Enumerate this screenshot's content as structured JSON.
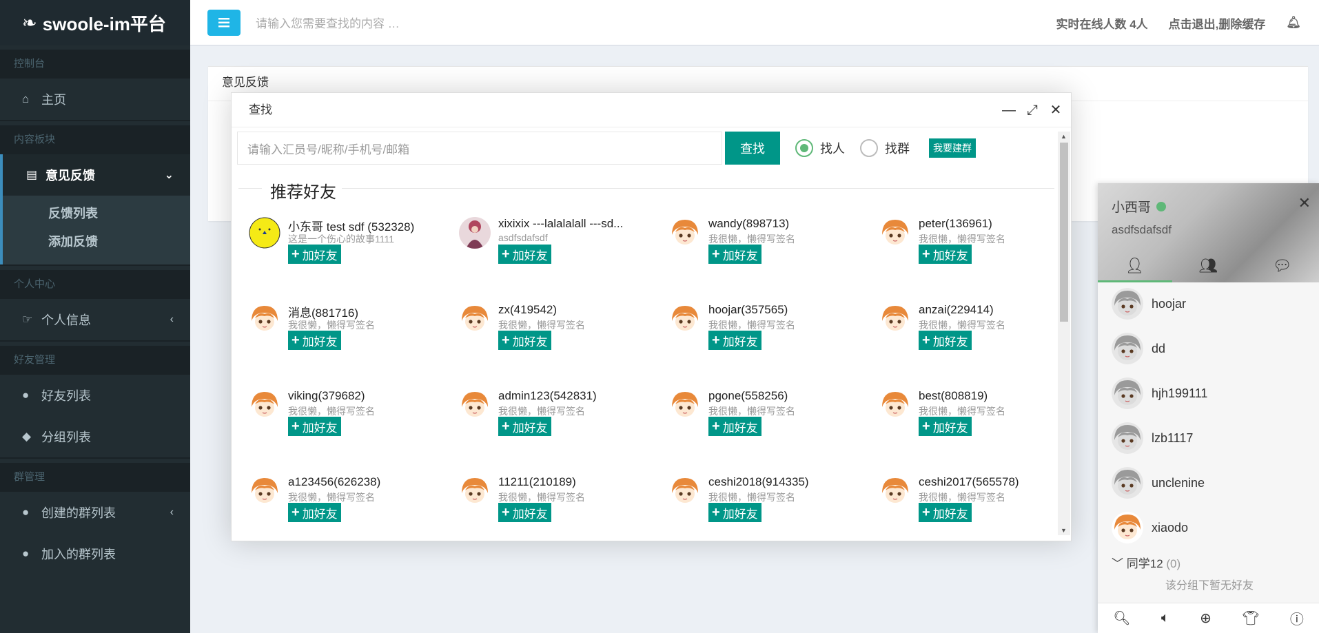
{
  "app": {
    "title": "swoole-im平台"
  },
  "sidebar": {
    "sections": [
      {
        "header": "控制台"
      },
      {
        "header": "内容板块"
      },
      {
        "header": "个人中心"
      },
      {
        "header": "好友管理"
      },
      {
        "header": "群管理"
      }
    ],
    "items": {
      "home": "主页",
      "feedback": "意见反馈",
      "feedback_list": "反馈列表",
      "feedback_add": "添加反馈",
      "profile": "个人信息",
      "friend_list": "好友列表",
      "group_list": "分组列表",
      "created_groups": "创建的群列表",
      "joined_groups": "加入的群列表"
    }
  },
  "topbar": {
    "search_placeholder": "请输入您需要查找的内容 …",
    "online_count": "实时在线人数 4人",
    "logout": "点击退出,删除缓存"
  },
  "panel": {
    "title": "意见反馈"
  },
  "modal": {
    "title": "查找",
    "search_placeholder": "请输入汇员号/昵称/手机号/邮箱",
    "search_button": "查找",
    "radio_person": "找人",
    "radio_group": "找群",
    "create_group": "我要建群",
    "recommend_title": "推荐好友",
    "add_label": "加好友",
    "users": [
      {
        "name": "小东哥 test sdf (532328)",
        "sign": "这是一个伤心的故事1111",
        "avatar": "smiley"
      },
      {
        "name": "xixixix ---lalalalall ---sd...",
        "sign": "asdfsdafsdf",
        "avatar": "photo"
      },
      {
        "name": "wandy(898713)",
        "sign": "我很懒，懒得写签名",
        "avatar": "anime"
      },
      {
        "name": "peter(136961)",
        "sign": "我很懒，懒得写签名",
        "avatar": "anime"
      },
      {
        "name": "消息(881716)",
        "sign": "我很懒，懒得写签名",
        "avatar": "anime"
      },
      {
        "name": "zx(419542)",
        "sign": "我很懒，懒得写签名",
        "avatar": "anime"
      },
      {
        "name": "hoojar(357565)",
        "sign": "我很懒，懒得写签名",
        "avatar": "anime"
      },
      {
        "name": "anzai(229414)",
        "sign": "我很懒，懒得写签名",
        "avatar": "anime"
      },
      {
        "name": "viking(379682)",
        "sign": "我很懒，懒得写签名",
        "avatar": "anime"
      },
      {
        "name": "admin123(542831)",
        "sign": "我很懒，懒得写签名",
        "avatar": "anime"
      },
      {
        "name": "pgone(558256)",
        "sign": "我很懒，懒得写签名",
        "avatar": "anime"
      },
      {
        "name": "best(808819)",
        "sign": "我很懒，懒得写签名",
        "avatar": "anime"
      },
      {
        "name": "a123456(626238)",
        "sign": "我很懒，懒得写签名",
        "avatar": "anime"
      },
      {
        "name": "11211(210189)",
        "sign": "我很懒，懒得写签名",
        "avatar": "anime"
      },
      {
        "name": "ceshi2018(914335)",
        "sign": "我很懒，懒得写签名",
        "avatar": "anime"
      },
      {
        "name": "ceshi2017(565578)",
        "sign": "我很懒，懒得写签名",
        "avatar": "anime"
      }
    ]
  },
  "im": {
    "username": "小西哥",
    "signature": "asdfsdafsdf",
    "friends": [
      {
        "name": "hoojar",
        "online": false
      },
      {
        "name": "dd",
        "online": false
      },
      {
        "name": "hjh199111",
        "online": false
      },
      {
        "name": "lzb1117",
        "online": false
      },
      {
        "name": "unclenine",
        "online": false
      },
      {
        "name": "xiaodo",
        "online": true
      }
    ],
    "group_name": "同学12",
    "group_count": "(0)",
    "empty_text": "该分组下暂无好友"
  },
  "colors": {
    "accent": "#009688",
    "sidebar": "#222d32",
    "online": "#5fb878",
    "menu_btn": "#1fb5e6"
  }
}
